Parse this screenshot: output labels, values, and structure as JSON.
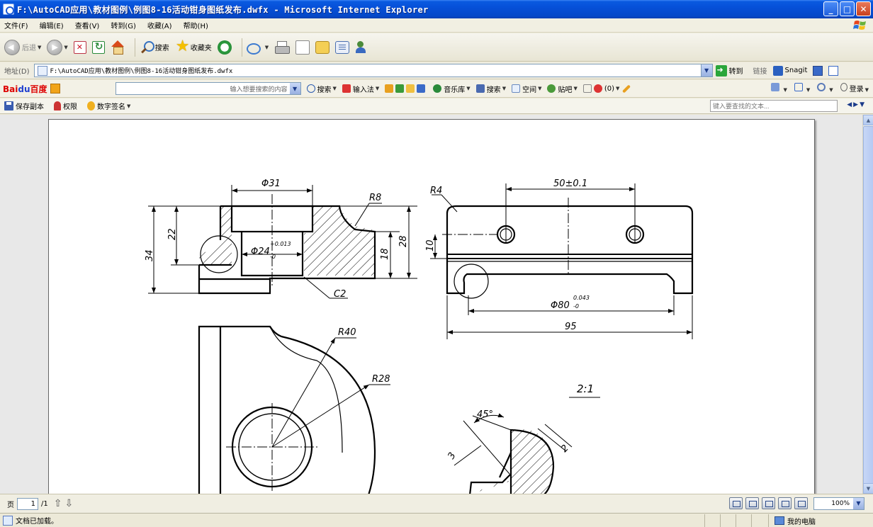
{
  "window": {
    "title": "F:\\AutoCAD应用\\教材图例\\例图8-16活动钳身图纸发布.dwfx - Microsoft Internet Explorer",
    "minimize": "_",
    "maximize": "□",
    "close": "✕"
  },
  "menu": [
    "文件(F)",
    "编辑(E)",
    "查看(V)",
    "转到(G)",
    "收藏(A)",
    "帮助(H)"
  ],
  "toolbar": {
    "back_label": "后退",
    "search_label": "搜索",
    "favorites_label": "收藏夹"
  },
  "address": {
    "label": "地址(D)",
    "value": "F:\\AutoCAD应用\\教材图例\\例图8-16活动钳身图纸发布.dwfx",
    "go_label": "转到",
    "links_label": "链接",
    "snagit_label": "Snagit"
  },
  "baidu": {
    "logo_left": "Bai",
    "logo_paw": "du",
    "logo_right": "百度",
    "search_placeholder": "输入想要搜索的内容",
    "items": [
      "搜索",
      "输入法",
      "音乐库",
      "搜索",
      "空间",
      "贴吧",
      "(0)"
    ],
    "right_login": "登录"
  },
  "viewer_toolbar": {
    "save_copy": "保存副本",
    "permissions": "权限",
    "digital_signature": "数字签名",
    "find_placeholder": "键入要查找的文本..."
  },
  "drawing": {
    "dims": {
      "d31": "Φ31",
      "r8": "R8",
      "d22": "22",
      "d34": "34",
      "d24": "Φ24",
      "tol24_up": "+0.013",
      "tol24_low": "-0",
      "d18": "18",
      "d28": "28",
      "c2": "C2",
      "r4": "R4",
      "d50": "50±0.1",
      "d10": "10",
      "d80": "Φ80",
      "tol80_up": "0.043",
      "tol80_low": "-0",
      "d95": "95",
      "r40": "R40",
      "r28": "R28",
      "scale": "2:1",
      "a45": "45°",
      "d3": "3",
      "d2": "2"
    }
  },
  "pagebar": {
    "page_prefix": "页",
    "page_value": "1",
    "page_total": "/1",
    "zoom": "100%"
  },
  "status": {
    "text": "文档已加载。",
    "zone": "我的电脑"
  }
}
